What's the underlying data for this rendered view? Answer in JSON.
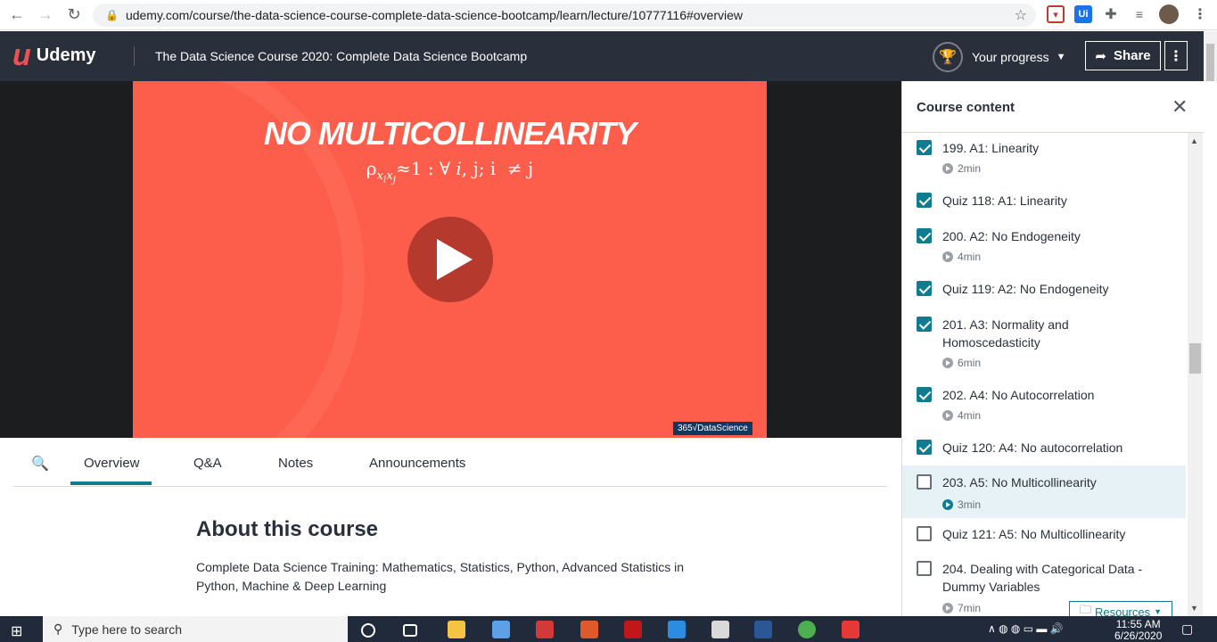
{
  "browser": {
    "url": "udemy.com/course/the-data-science-course-complete-data-science-bootcamp/learn/lecture/10777116#overview",
    "extensions": [
      "shield-extension",
      "Ui",
      "puzzle",
      "playlist",
      "profile-avatar"
    ]
  },
  "header": {
    "logo_text": "Udemy",
    "course_title": "The Data Science Course 2020: Complete Data Science Bootcamp",
    "progress_label": "Your progress",
    "share_label": "Share"
  },
  "video": {
    "slide_title": "NO MULTICOLLINEARITY",
    "formula": "ρ x_i x_j ≈ 1 : ∀ i, j; i ≠ j",
    "watermark": "365√DataScience"
  },
  "tabs": {
    "items": [
      "Overview",
      "Q&A",
      "Notes",
      "Announcements"
    ],
    "active": "Overview"
  },
  "about": {
    "title": "About this course",
    "description": "Complete Data Science Training: Mathematics, Statistics, Python, Advanced Statistics in Python, Machine & Deep Learning"
  },
  "sidebar": {
    "title": "Course content",
    "items": [
      {
        "label": "199. A1: Linearity",
        "duration": "2min",
        "checked": true
      },
      {
        "label": "Quiz 118: A1: Linearity",
        "duration": "",
        "checked": true
      },
      {
        "label": "200. A2: No Endogeneity",
        "duration": "4min",
        "checked": true
      },
      {
        "label": "Quiz 119: A2: No Endogeneity",
        "duration": "",
        "checked": true
      },
      {
        "label": "201. A3: Normality and Homoscedasticity",
        "duration": "6min",
        "checked": true
      },
      {
        "label": "202. A4: No Autocorrelation",
        "duration": "4min",
        "checked": true
      },
      {
        "label": "Quiz 120: A4: No autocorrelation",
        "duration": "",
        "checked": true
      },
      {
        "label": "203. A5: No Multicollinearity",
        "duration": "3min",
        "checked": false
      },
      {
        "label": "Quiz 121: A5: No Multicollinearity",
        "duration": "",
        "checked": false
      },
      {
        "label": "204. Dealing with Categorical Data - Dummy Variables",
        "duration": "7min",
        "checked": false
      }
    ],
    "resources_label": "Resources"
  },
  "taskbar": {
    "search_placeholder": "Type here to search",
    "time": "11:55 AM",
    "date": "6/26/2020"
  },
  "colors": {
    "header_bg": "#29303b",
    "accent": "#0f7c90",
    "slide_bg": "#fd5e4b",
    "brand": "#ec5252"
  }
}
